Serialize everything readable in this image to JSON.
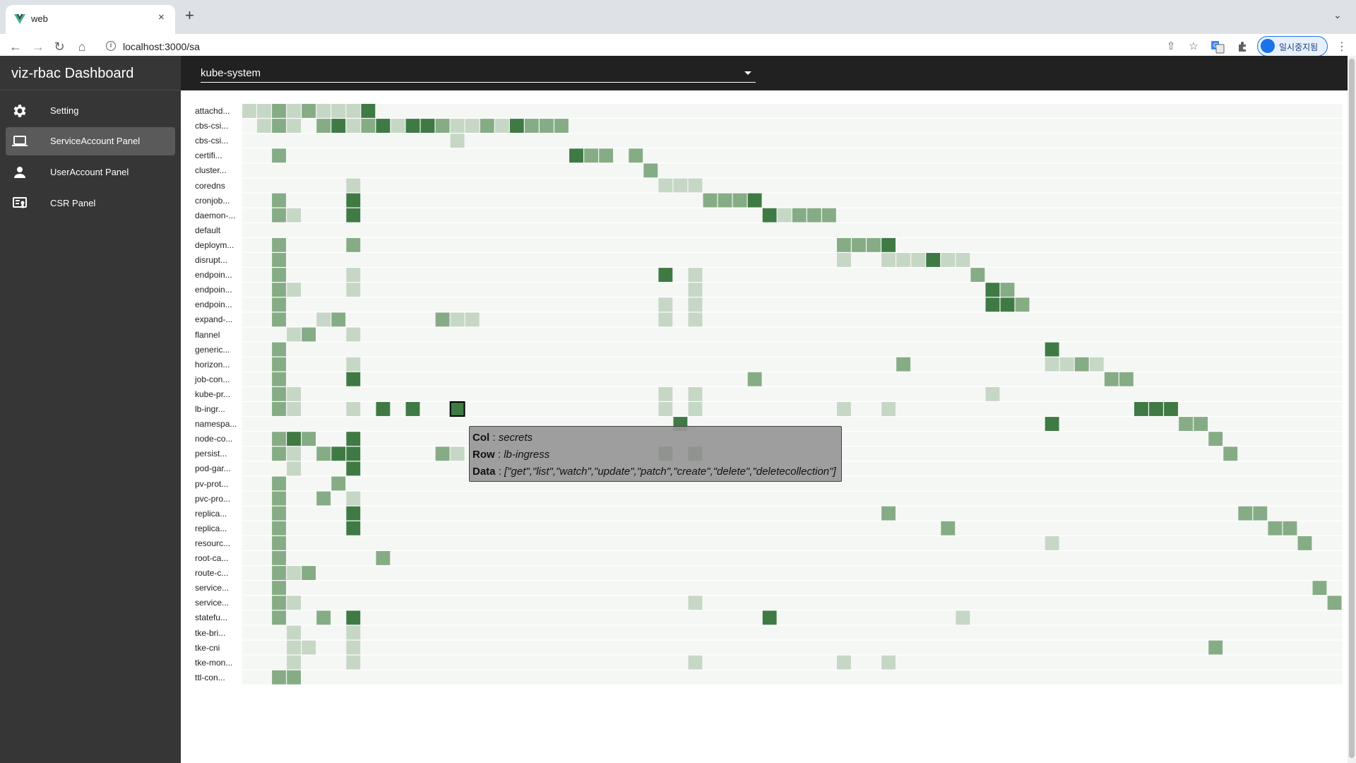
{
  "browser": {
    "tab_title": "web",
    "tab_close": "×",
    "new_tab": "+",
    "tab_list": "⌄",
    "url": "localhost:3000/sa",
    "profile_label": "일시중지됨",
    "menu": "⋮"
  },
  "app": {
    "title": "viz-rbac Dashboard",
    "namespace": "kube-system",
    "nav": [
      {
        "label": "Setting",
        "icon": "gear-icon"
      },
      {
        "label": "ServiceAccount Panel",
        "icon": "laptop-icon"
      },
      {
        "label": "UserAccount Panel",
        "icon": "person-icon"
      },
      {
        "label": "CSR Panel",
        "icon": "certificate-icon"
      }
    ],
    "active_nav": 1
  },
  "tooltip": {
    "col_key": "Col",
    "col_value": "secrets",
    "row_key": "Row",
    "row_value": "lb-ingress",
    "data_key": "Data",
    "data_value": "[\"get\",\"list\",\"watch\",\"update\",\"patch\",\"create\",\"delete\",\"deletecollection\"]",
    "sep": " : "
  },
  "colors": {
    "empty": "#f5f7f5",
    "level1": "#c6d7c6",
    "level2": "#86ac86",
    "level3": "#3f7a45",
    "highlight_border": "#000000"
  },
  "heatmap": {
    "rows": [
      "attachd...",
      "cbs-csi...",
      "cbs-csi...",
      "certifi...",
      "cluster...",
      "coredns",
      "cronjob...",
      "daemon-...",
      "default",
      "deploym...",
      "disrupt...",
      "endpoin...",
      "endpoin...",
      "endpoin...",
      "expand-...",
      "flannel",
      "generic...",
      "horizon...",
      "job-con...",
      "kube-pr...",
      "lb-ingr...",
      "namespa...",
      "node-co...",
      "persist...",
      "pod-gar...",
      "pv-prot...",
      "pvc-pro...",
      "replica...",
      "replica...",
      "resourc...",
      "root-ca...",
      "route-c...",
      "service...",
      "service...",
      "statefu...",
      "tke-bri...",
      "tke-cni",
      "tke-mon...",
      "ttl-con..."
    ],
    "column_count": 74,
    "highlight": {
      "row": 20,
      "col": 14
    },
    "cells": [
      [
        [
          0,
          1
        ],
        [
          1,
          1
        ],
        [
          2,
          2
        ],
        [
          3,
          1
        ],
        [
          4,
          2
        ],
        [
          5,
          1
        ],
        [
          6,
          1
        ],
        [
          7,
          1
        ],
        [
          8,
          3
        ]
      ],
      [
        [
          1,
          1
        ],
        [
          2,
          2
        ],
        [
          3,
          1
        ],
        [
          5,
          2
        ],
        [
          6,
          3
        ],
        [
          7,
          1
        ],
        [
          8,
          2
        ],
        [
          9,
          3
        ],
        [
          10,
          1
        ],
        [
          11,
          3
        ],
        [
          12,
          3
        ],
        [
          13,
          2
        ],
        [
          14,
          1
        ],
        [
          15,
          1
        ],
        [
          16,
          2
        ],
        [
          17,
          1
        ],
        [
          18,
          3
        ],
        [
          19,
          2
        ],
        [
          20,
          2
        ],
        [
          21,
          2
        ]
      ],
      [
        [
          14,
          1
        ]
      ],
      [
        [
          2,
          2
        ],
        [
          22,
          3
        ],
        [
          23,
          2
        ],
        [
          24,
          2
        ],
        [
          26,
          2
        ]
      ],
      [
        [
          27,
          2
        ]
      ],
      [
        [
          7,
          1
        ],
        [
          28,
          1
        ],
        [
          29,
          1
        ],
        [
          30,
          1
        ]
      ],
      [
        [
          2,
          2
        ],
        [
          7,
          3
        ],
        [
          31,
          2
        ],
        [
          32,
          2
        ],
        [
          33,
          2
        ],
        [
          34,
          3
        ]
      ],
      [
        [
          2,
          2
        ],
        [
          3,
          1
        ],
        [
          7,
          3
        ],
        [
          35,
          3
        ],
        [
          36,
          1
        ],
        [
          37,
          2
        ],
        [
          38,
          2
        ],
        [
          39,
          2
        ]
      ],
      [],
      [
        [
          2,
          2
        ],
        [
          7,
          2
        ],
        [
          40,
          2
        ],
        [
          41,
          2
        ],
        [
          42,
          2
        ],
        [
          43,
          3
        ]
      ],
      [
        [
          2,
          2
        ],
        [
          40,
          1
        ],
        [
          43,
          1
        ],
        [
          44,
          1
        ],
        [
          45,
          1
        ],
        [
          46,
          3
        ],
        [
          47,
          1
        ],
        [
          48,
          1
        ]
      ],
      [
        [
          2,
          2
        ],
        [
          7,
          1
        ],
        [
          28,
          3
        ],
        [
          30,
          1
        ],
        [
          49,
          2
        ]
      ],
      [
        [
          2,
          2
        ],
        [
          3,
          1
        ],
        [
          7,
          1
        ],
        [
          30,
          1
        ],
        [
          50,
          3
        ],
        [
          51,
          2
        ]
      ],
      [
        [
          2,
          2
        ],
        [
          28,
          1
        ],
        [
          30,
          1
        ],
        [
          50,
          3
        ],
        [
          51,
          3
        ],
        [
          52,
          2
        ]
      ],
      [
        [
          2,
          2
        ],
        [
          5,
          1
        ],
        [
          6,
          2
        ],
        [
          13,
          2
        ],
        [
          14,
          1
        ],
        [
          15,
          1
        ],
        [
          28,
          1
        ],
        [
          30,
          1
        ]
      ],
      [
        [
          3,
          1
        ],
        [
          4,
          2
        ],
        [
          7,
          1
        ]
      ],
      [
        [
          2,
          2
        ],
        [
          54,
          3
        ]
      ],
      [
        [
          2,
          2
        ],
        [
          7,
          1
        ],
        [
          44,
          2
        ],
        [
          54,
          1
        ],
        [
          55,
          1
        ],
        [
          56,
          2
        ],
        [
          57,
          1
        ]
      ],
      [
        [
          2,
          2
        ],
        [
          7,
          3
        ],
        [
          34,
          2
        ],
        [
          58,
          2
        ],
        [
          59,
          2
        ]
      ],
      [
        [
          2,
          2
        ],
        [
          3,
          1
        ],
        [
          28,
          1
        ],
        [
          30,
          1
        ],
        [
          50,
          1
        ]
      ],
      [
        [
          2,
          2
        ],
        [
          3,
          1
        ],
        [
          7,
          1
        ],
        [
          9,
          3
        ],
        [
          11,
          3
        ],
        [
          14,
          3
        ],
        [
          28,
          1
        ],
        [
          30,
          1
        ],
        [
          40,
          1
        ],
        [
          43,
          1
        ],
        [
          60,
          3
        ],
        [
          61,
          3
        ],
        [
          62,
          3
        ]
      ],
      [
        [
          29,
          3
        ],
        [
          54,
          3
        ],
        [
          63,
          2
        ],
        [
          64,
          2
        ]
      ],
      [
        [
          2,
          2
        ],
        [
          3,
          3
        ],
        [
          4,
          2
        ],
        [
          7,
          3
        ],
        [
          65,
          2
        ]
      ],
      [
        [
          2,
          2
        ],
        [
          3,
          1
        ],
        [
          5,
          2
        ],
        [
          6,
          3
        ],
        [
          7,
          3
        ],
        [
          13,
          2
        ],
        [
          14,
          1
        ],
        [
          28,
          3
        ],
        [
          30,
          3
        ],
        [
          66,
          2
        ]
      ],
      [
        [
          3,
          1
        ],
        [
          7,
          3
        ]
      ],
      [
        [
          2,
          2
        ],
        [
          6,
          2
        ]
      ],
      [
        [
          2,
          2
        ],
        [
          5,
          2
        ],
        [
          7,
          1
        ]
      ],
      [
        [
          2,
          2
        ],
        [
          7,
          3
        ],
        [
          43,
          2
        ],
        [
          67,
          2
        ],
        [
          68,
          2
        ]
      ],
      [
        [
          2,
          2
        ],
        [
          7,
          3
        ],
        [
          47,
          2
        ],
        [
          69,
          2
        ],
        [
          70,
          2
        ]
      ],
      [
        [
          2,
          2
        ],
        [
          54,
          1
        ],
        [
          71,
          2
        ]
      ],
      [
        [
          2,
          2
        ],
        [
          9,
          2
        ]
      ],
      [
        [
          2,
          2
        ],
        [
          3,
          1
        ],
        [
          4,
          2
        ]
      ],
      [
        [
          2,
          2
        ],
        [
          72,
          2
        ]
      ],
      [
        [
          2,
          2
        ],
        [
          3,
          1
        ],
        [
          30,
          1
        ],
        [
          73,
          2
        ]
      ],
      [
        [
          2,
          2
        ],
        [
          5,
          2
        ],
        [
          7,
          3
        ],
        [
          35,
          3
        ],
        [
          48,
          1
        ]
      ],
      [
        [
          3,
          1
        ],
        [
          7,
          1
        ]
      ],
      [
        [
          3,
          1
        ],
        [
          4,
          1
        ],
        [
          7,
          1
        ],
        [
          65,
          2
        ]
      ],
      [
        [
          3,
          1
        ],
        [
          7,
          1
        ],
        [
          30,
          1
        ],
        [
          40,
          1
        ],
        [
          43,
          1
        ]
      ],
      [
        [
          2,
          2
        ],
        [
          3,
          2
        ]
      ]
    ]
  }
}
